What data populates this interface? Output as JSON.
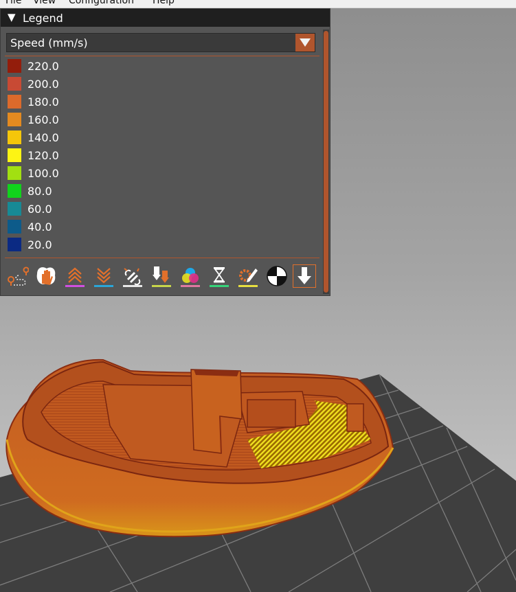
{
  "menubar": {
    "items": [
      "File",
      "View",
      "Configuration",
      "Help"
    ]
  },
  "legend": {
    "title": "Legend",
    "view_type": "Speed (mm/s)",
    "accent_color": "#b0552d",
    "items": [
      {
        "label": "220.0",
        "color": "#931d0b"
      },
      {
        "label": "200.0",
        "color": "#c84a34"
      },
      {
        "label": "180.0",
        "color": "#dc6a2b"
      },
      {
        "label": "160.0",
        "color": "#e48a20"
      },
      {
        "label": "140.0",
        "color": "#f5c60a"
      },
      {
        "label": "120.0",
        "color": "#fdf414"
      },
      {
        "label": "100.0",
        "color": "#a2e011"
      },
      {
        "label": "80.0",
        "color": "#11d31c"
      },
      {
        "label": "60.0",
        "color": "#178a95"
      },
      {
        "label": "40.0",
        "color": "#0d5b8a"
      },
      {
        "label": "20.0",
        "color": "#0b2a83"
      }
    ]
  },
  "toolbar": {
    "tools": [
      {
        "name": "travel-icon",
        "underline": ""
      },
      {
        "name": "wipe-icon",
        "underline": ""
      },
      {
        "name": "retractions-icon",
        "underline": "#d14fe0"
      },
      {
        "name": "deretractions-icon",
        "underline": "#2aa6d8"
      },
      {
        "name": "seams-icon",
        "underline": "#e8e8e8"
      },
      {
        "name": "tool-changes-icon",
        "underline": "#c8d64a"
      },
      {
        "name": "color-changes-icon",
        "underline": "#e078a0"
      },
      {
        "name": "pause-prints-icon",
        "underline": "#36d47a"
      },
      {
        "name": "custom-gcodes-icon",
        "underline": "#e8e040"
      },
      {
        "name": "center-of-gravity-icon",
        "underline": ""
      },
      {
        "name": "tool-marker-icon",
        "underline": ""
      }
    ]
  }
}
